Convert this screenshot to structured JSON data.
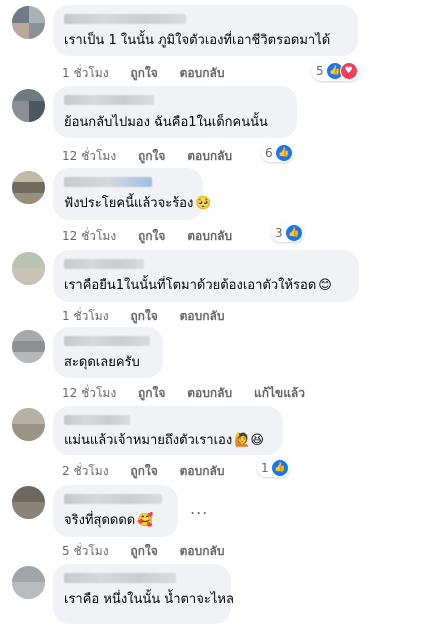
{
  "actions": {
    "like": "ถูกใจ",
    "reply": "ตอบกลับ"
  },
  "colors": {
    "bubble": "#f0f2f5",
    "meta": "#65676b",
    "like_blue": "#1877f2",
    "love_red": "#f33e58"
  },
  "comments": [
    {
      "text": "เราเป็น 1 ในนั้น ภูมิใจตัวเองที่เอาชีวิตรอดมาได้",
      "time": "1 ชั่วโมง",
      "reactions": "5",
      "emoji": ""
    },
    {
      "text": "ย้อนกลับไปมอง ฉันคือ1ในเด็กคนนั้น",
      "time": "12 ชั่วโมง",
      "reactions": "6",
      "emoji": ""
    },
    {
      "text": "ฟังประโยคนี้แล้วจะร้อง",
      "time": "12 ชั่วโมง",
      "reactions": "3",
      "emoji": "🥺"
    },
    {
      "text": "เราคือยืน1ในนั้นที่โตมาด้วยต้องเอาตัวให้รอด",
      "time": "1 ชั่วโมง",
      "reactions": "",
      "emoji": "😊"
    },
    {
      "text": "สะดุดเลยครับ",
      "time": "12 ชั่วโมง",
      "reactions": "",
      "emoji": "",
      "extra_action": "แก้ไขแล้ว"
    },
    {
      "text": "แม่นแล้วเจ้าหมายถึงตัวเราเอง",
      "time": "2 ชั่วโมง",
      "reactions": "1",
      "emoji": "🙋😆"
    },
    {
      "text": "จริงที่สุดดดด",
      "time": "5 ชั่วโมง",
      "reactions": "",
      "emoji": "🥰",
      "more": "..."
    },
    {
      "text": "เราคือ หนึ่งในนั้น น้ำตาจะไหล",
      "time": "",
      "reactions": "",
      "emoji": ""
    }
  ]
}
